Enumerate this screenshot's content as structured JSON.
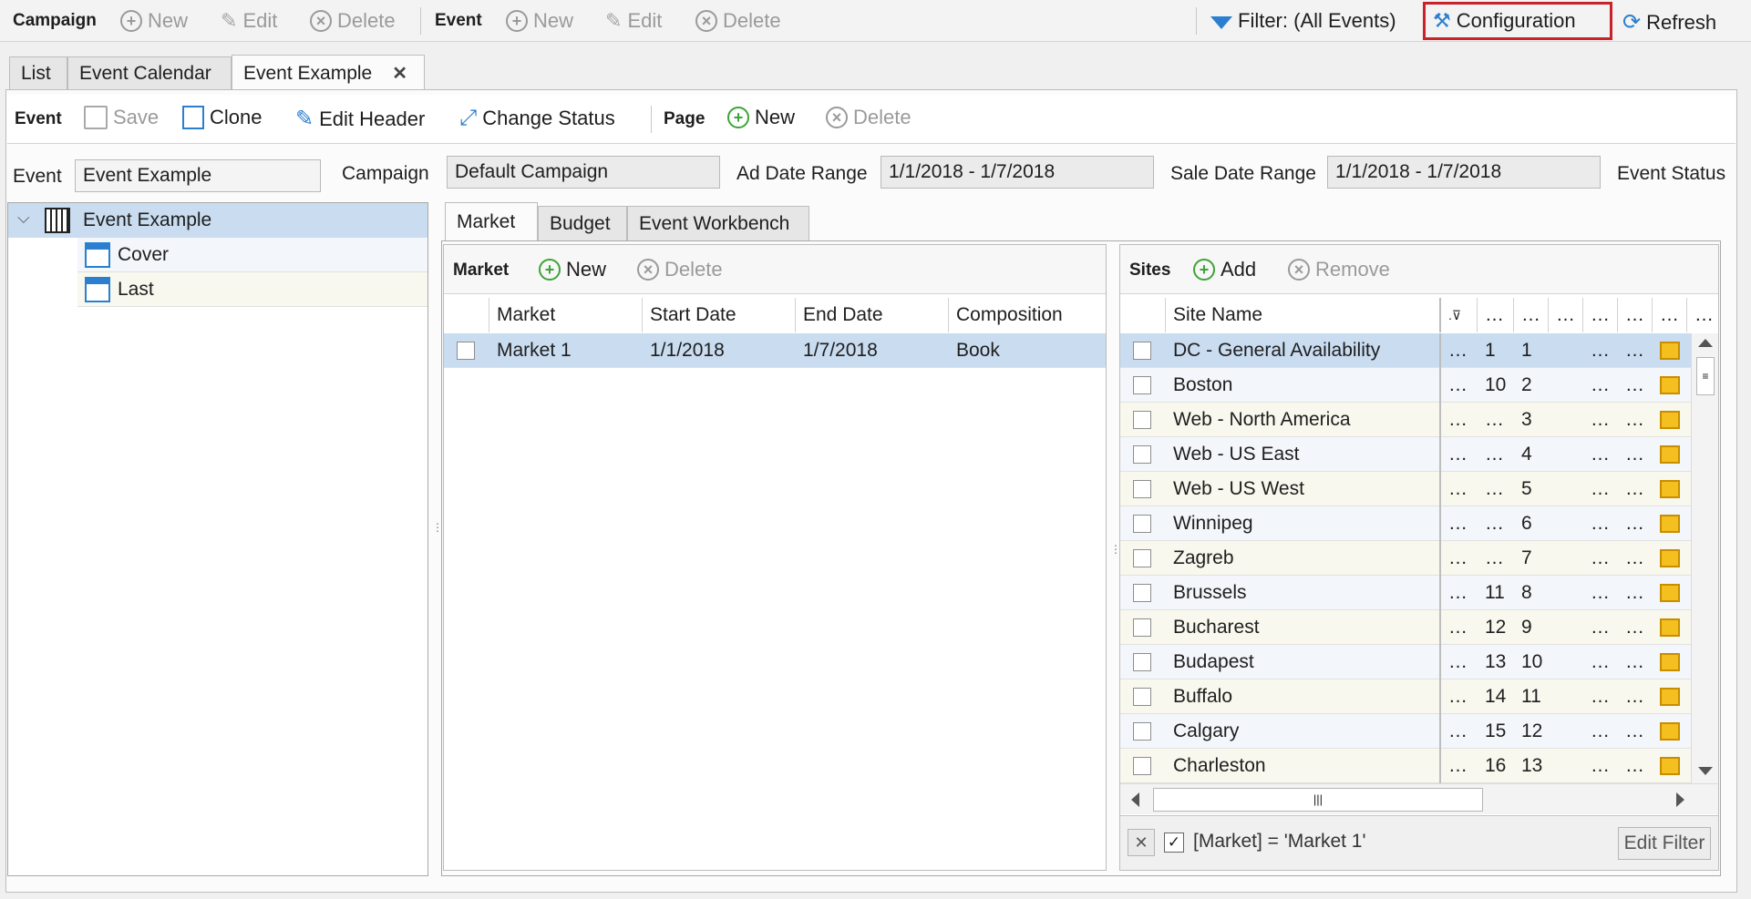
{
  "toolbar": {
    "campaign_group": "Campaign",
    "campaign_new": "New",
    "campaign_edit": "Edit",
    "campaign_delete": "Delete",
    "event_group": "Event",
    "event_new": "New",
    "event_edit": "Edit",
    "event_delete": "Delete",
    "filter": "Filter: (All Events)",
    "configuration": "Configuration",
    "refresh": "Refresh"
  },
  "tabs": [
    "List",
    "Event Calendar",
    "Event Example"
  ],
  "tab_close": "✕",
  "event_toolbar": {
    "event_group": "Event",
    "save": "Save",
    "clone": "Clone",
    "edit_header": "Edit Header",
    "change_status": "Change Status",
    "page_group": "Page",
    "page_new": "New",
    "page_delete": "Delete"
  },
  "header_fields": {
    "event_label": "Event",
    "event_value": "Event Example",
    "campaign_label": "Campaign",
    "campaign_value": "Default Campaign",
    "ad_date_label": "Ad Date Range",
    "ad_date_value": "1/1/2018 - 1/7/2018",
    "sale_date_label": "Sale Date Range",
    "sale_date_value": "1/1/2018 - 1/7/2018",
    "status_label": "Event Status"
  },
  "tree": {
    "root": "Event Example",
    "children": [
      "Cover",
      "Last"
    ]
  },
  "inner_tabs": [
    "Market",
    "Budget",
    "Event Workbench"
  ],
  "market_panel": {
    "title": "Market",
    "new": "New",
    "delete": "Delete",
    "columns": [
      "Market",
      "Start Date",
      "End Date",
      "Composition"
    ],
    "rows": [
      {
        "market": "Market 1",
        "start": "1/1/2018",
        "end": "1/7/2018",
        "composition": "Book"
      }
    ]
  },
  "sites_panel": {
    "title": "Sites",
    "add": "Add",
    "remove": "Remove",
    "column_site": "Site Name",
    "ellipsis": "…",
    "rows": [
      {
        "name": "DC - General Availability",
        "a": "…",
        "b": "1",
        "c": "1"
      },
      {
        "name": "Boston",
        "a": "…",
        "b": "10",
        "c": "2"
      },
      {
        "name": "Web - North America",
        "a": "…",
        "b": "…",
        "c": "3"
      },
      {
        "name": "Web - US East",
        "a": "…",
        "b": "…",
        "c": "4"
      },
      {
        "name": "Web - US West",
        "a": "…",
        "b": "…",
        "c": "5"
      },
      {
        "name": "Winnipeg",
        "a": "…",
        "b": "…",
        "c": "6"
      },
      {
        "name": "Zagreb",
        "a": "…",
        "b": "…",
        "c": "7"
      },
      {
        "name": "Brussels",
        "a": "…",
        "b": "11",
        "c": "8"
      },
      {
        "name": "Bucharest",
        "a": "…",
        "b": "12",
        "c": "9"
      },
      {
        "name": "Budapest",
        "a": "…",
        "b": "13",
        "c": "10"
      },
      {
        "name": "Buffalo",
        "a": "…",
        "b": "14",
        "c": "11"
      },
      {
        "name": "Calgary",
        "a": "…",
        "b": "15",
        "c": "12"
      },
      {
        "name": "Charleston",
        "a": "…",
        "b": "16",
        "c": "13"
      }
    ],
    "filter_text": "[Market] = 'Market 1'",
    "edit_filter": "Edit Filter"
  },
  "colors": {
    "accent_border": "#c8222a",
    "selected_row": "#c9dcf0",
    "alt_row": "#f8f8ee",
    "green_icon": "#3ca435",
    "blue_icon": "#2a7fd0"
  }
}
